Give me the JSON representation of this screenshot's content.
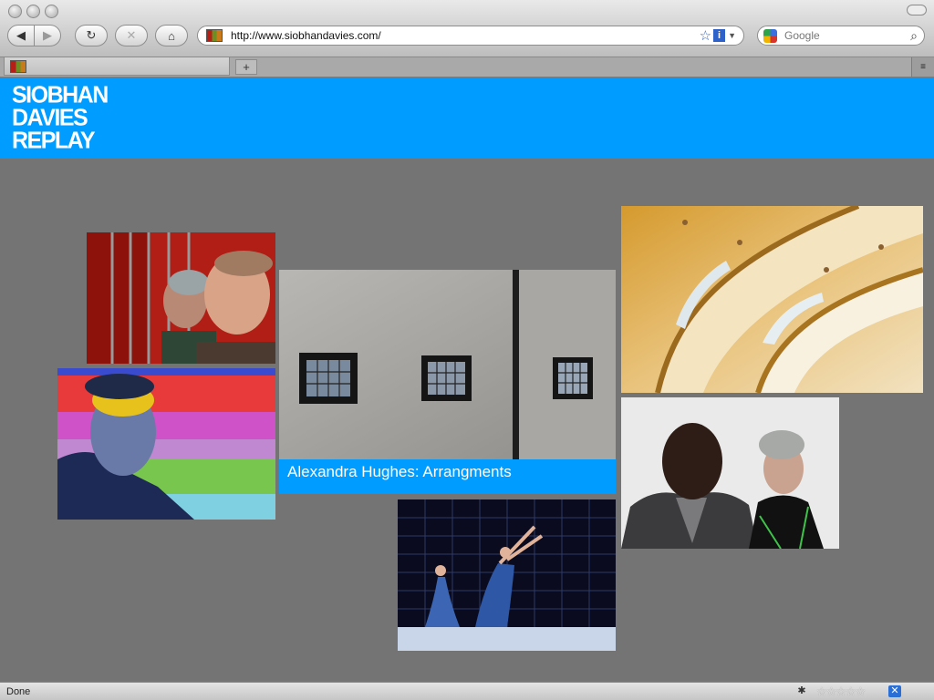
{
  "browser": {
    "url": "http://www.siobhandavies.com/",
    "search_placeholder": "Google",
    "new_tab_label": "+",
    "nav": {
      "back": "◀",
      "forward": "▶",
      "reload": "↻",
      "stop": "✕",
      "home": "⌂"
    },
    "star": "☆",
    "info": "i",
    "dropdown": "▼",
    "search_glass": "⌕",
    "tablist": "≡"
  },
  "page": {
    "logo_lines": [
      "SIOBHAN",
      "DAVIES",
      "REPLAY"
    ],
    "caption": "Alexandra Hughes: Arrangments",
    "accent_color": "#009cff"
  },
  "status": {
    "text": "Done",
    "stars": "☆☆☆☆☆"
  }
}
